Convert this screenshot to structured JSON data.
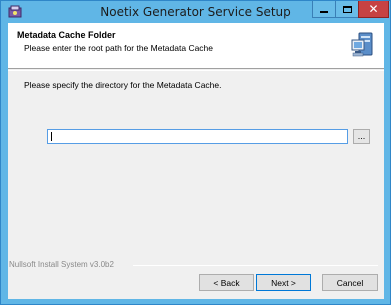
{
  "window": {
    "title": "Noetix Generator Service Setup",
    "close_glyph": "✕",
    "app_icon": "installer-icon"
  },
  "header": {
    "title": "Metadata Cache Folder",
    "subtitle": "Please enter the root path for the Metadata Cache",
    "icon": "computer-icon"
  },
  "main": {
    "prompt": "Please specify the directory for the Metadata Cache.",
    "directory_value": "",
    "browse_label": "..."
  },
  "footer": {
    "branding": "Nullsoft Install System v3.0b2",
    "back_label": "< Back",
    "next_label": "Next >",
    "cancel_label": "Cancel"
  },
  "colors": {
    "titlebar": "#60b6e6",
    "close_button": "#c74242",
    "input_focus_border": "#569de5"
  }
}
